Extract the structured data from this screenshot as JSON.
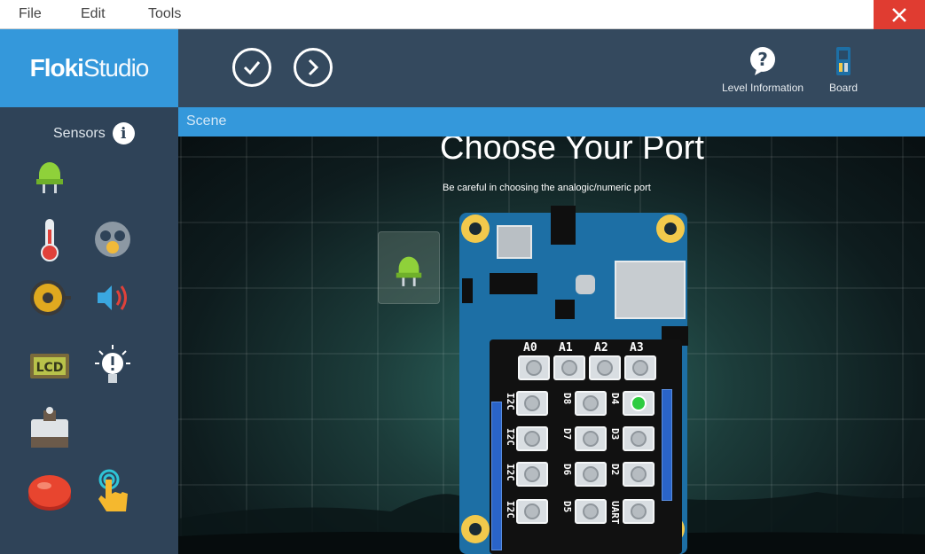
{
  "menu": {
    "file": "File",
    "edit": "Edit",
    "tools": "Tools"
  },
  "logo": {
    "bold": "Floki",
    "light": "Studio"
  },
  "toolbar": {
    "level_info_label": "Level Information",
    "board_label": "Board"
  },
  "sidebar": {
    "title": "Sensors",
    "items": [
      "led-sensor",
      "temperature-sensor",
      "gas-sensor",
      "buzzer",
      "sound-sensor",
      "lcd-display",
      "light-bulb",
      "servo-motor",
      "push-button",
      "touch-sensor"
    ]
  },
  "scene": {
    "title": "Scene",
    "dialog_title": "Choose Your Port",
    "dialog_subtitle": "Be careful in choosing the analogic/numeric port"
  },
  "board": {
    "analog_ports": [
      "A0",
      "A1",
      "A2",
      "A3"
    ],
    "rows": [
      {
        "left": "I2C",
        "mid": "D8",
        "right": "D4"
      },
      {
        "left": "I2C",
        "mid": "D7",
        "right": "D3"
      },
      {
        "left": "I2C",
        "mid": "D6",
        "right": "D2"
      },
      {
        "left": "I2C",
        "mid": "D5",
        "right": "UART"
      }
    ],
    "selected_port": "D4"
  },
  "colors": {
    "accent": "#3498db",
    "header": "#34495e",
    "sidebar": "#2f4358",
    "close": "#e03c31",
    "selected": "#2ecc40"
  }
}
